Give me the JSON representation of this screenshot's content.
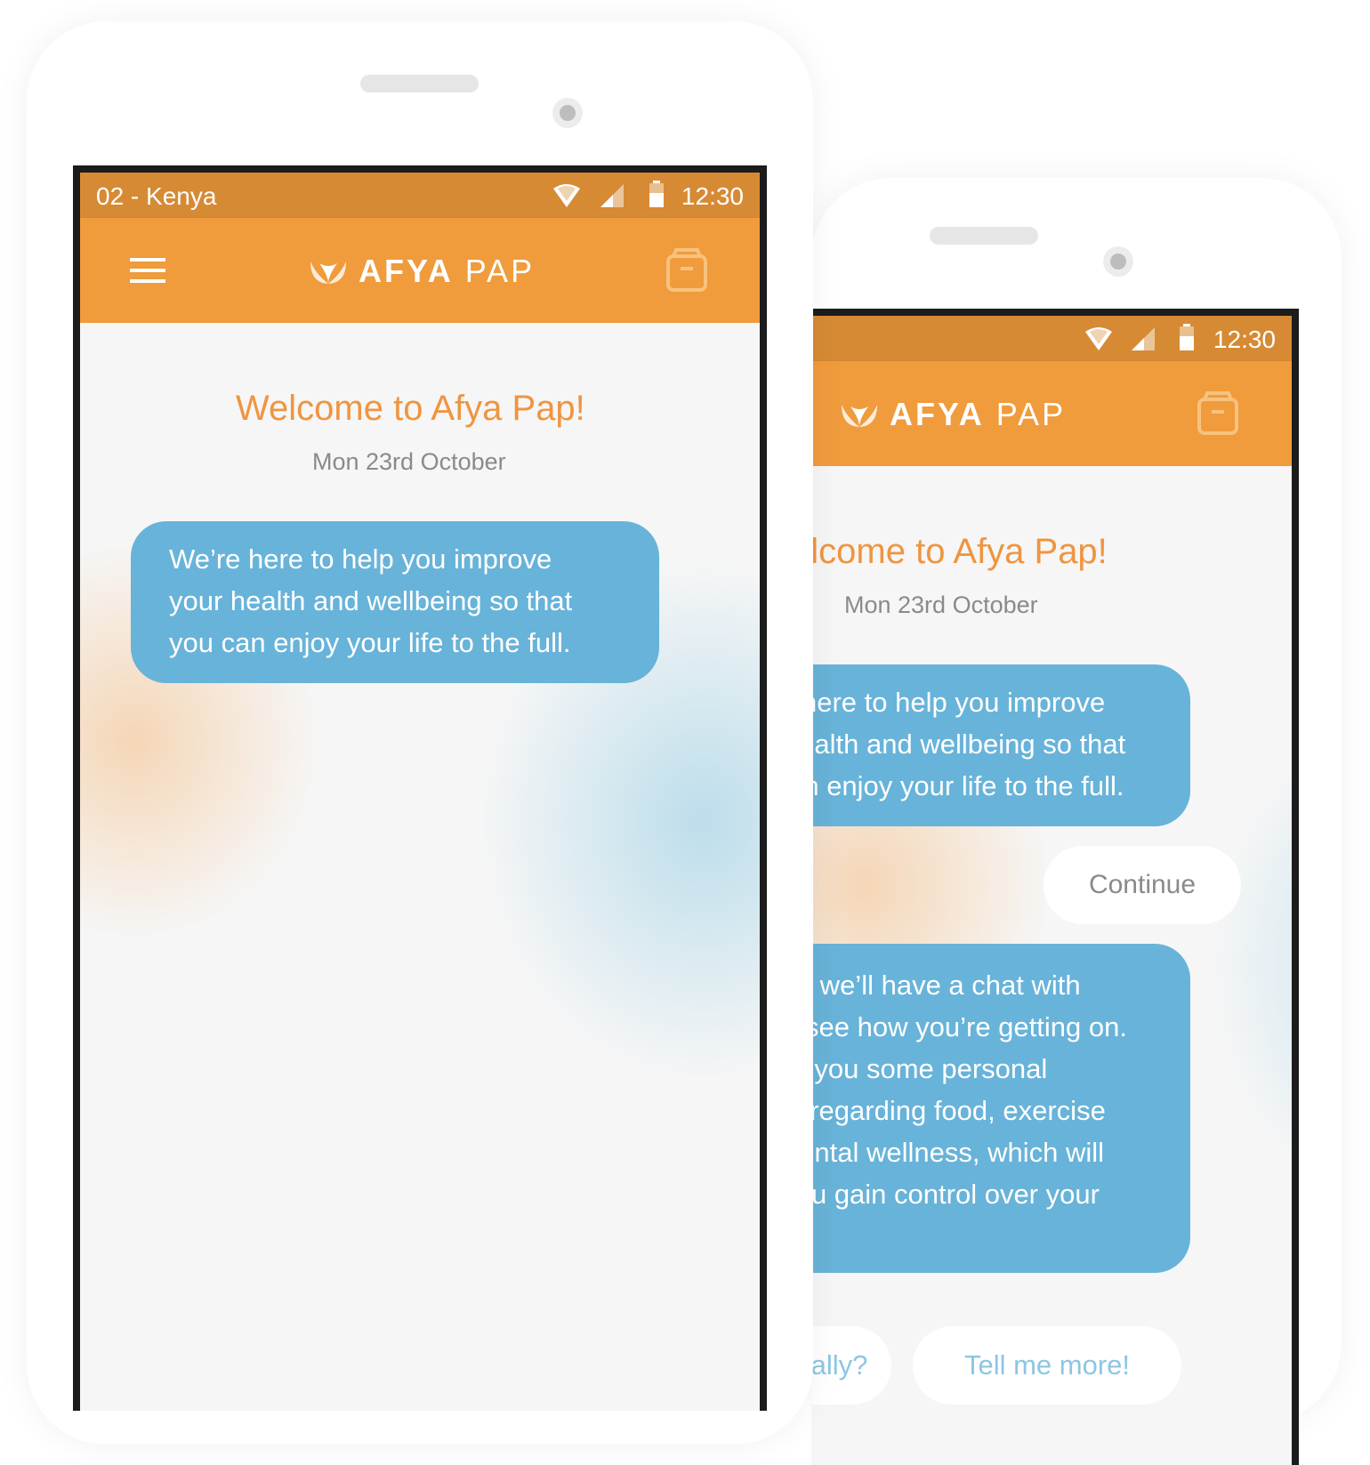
{
  "front": {
    "status": {
      "carrier": "02 - Kenya",
      "time": "12:30"
    },
    "toolbar": {
      "brand_bold": "AFYA",
      "brand_light": "PAP"
    },
    "welcome_title": "Welcome to Afya Pap!",
    "date": "Mon 23rd October",
    "message_lines": [
      "We’re here to help you improve",
      "your health and wellbeing  so that",
      "you can enjoy your life to the full."
    ]
  },
  "back": {
    "status": {
      "time": "12:30"
    },
    "toolbar": {
      "brand_bold": "AFYA",
      "brand_light": "PAP"
    },
    "welcome_title": "Welcome to Afya Pap!",
    "date": "Mon 23rd October",
    "message1_lines": [
      "We’re here to help you improve",
      "your health and wellbeing  so that",
      "you can enjoy your life to the full."
    ],
    "continue_label": "Continue",
    "message2_lines": [
      "Weekly we’ll have a chat with",
      "you to see how you’re getting on.",
      "I’ll give you some personal",
      "advice regarding food, exercise",
      "and mental wellness, which will",
      "help you gain control over your"
    ],
    "reply_left_label": "Really?",
    "reply_right_label": "Tell me more!"
  },
  "colors": {
    "accent": "#f09b3c",
    "status_bar": "#d78a34",
    "bubble": "#68b3d9",
    "title": "#ef9540"
  },
  "icons": {
    "menu": "hamburger-icon",
    "logo": "leaf-logo-icon",
    "bag": "bag-icon",
    "wifi": "wifi-icon",
    "signal": "signal-icon",
    "battery": "battery-icon"
  }
}
